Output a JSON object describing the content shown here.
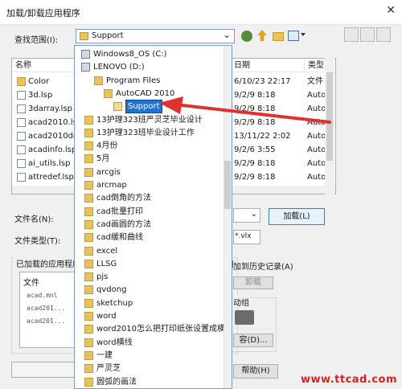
{
  "window": {
    "title": "加载/卸载应用程序",
    "close_glyph": "✕"
  },
  "search": {
    "label": "查找范围(I):",
    "current": "Support",
    "arrow": "⌄"
  },
  "columns": {
    "name": "名称",
    "date": "日期",
    "type": "类型"
  },
  "files": [
    {
      "name": "Color",
      "kind": "folder",
      "date": "6/10/23 22:17",
      "type": "文件"
    },
    {
      "name": "3d.lsp",
      "kind": "file",
      "date": "9/2/9 8:18",
      "type": "Autoc"
    },
    {
      "name": "3darray.lsp",
      "kind": "file",
      "date": "9/2/9 8:18",
      "type": "Autoc"
    },
    {
      "name": "acad2010.ls",
      "kind": "file",
      "date": "9/2/9 8:18",
      "type": "Autoc"
    },
    {
      "name": "acad2010do",
      "kind": "file",
      "date": "13/11/22 2:02",
      "type": "Autoc"
    },
    {
      "name": "acadinfo.lsp",
      "kind": "file",
      "date": "9/2/6 3:55",
      "type": "Autoc"
    },
    {
      "name": "ai_utils.lsp",
      "kind": "file",
      "date": "9/2/9 8:18",
      "type": "Autoc"
    },
    {
      "name": "attredef.lsp",
      "kind": "file",
      "date": "9/2/9 8:18",
      "type": "Autoc"
    }
  ],
  "dropdown": [
    {
      "text": "Windows8_OS (C:)",
      "kind": "drive",
      "indent": 0
    },
    {
      "text": "LENOVO (D:)",
      "kind": "drive",
      "indent": 0
    },
    {
      "text": "Program Files",
      "kind": "folder",
      "indent": 1
    },
    {
      "text": "AutoCAD 2010",
      "kind": "folder",
      "indent": 2
    },
    {
      "text": "Support",
      "kind": "folder-open",
      "indent": 3,
      "selected": true
    },
    {
      "text": "13护理323班严灵芝毕业设计",
      "kind": "folder",
      "indent": -1
    },
    {
      "text": "13护理323班毕业设计工作",
      "kind": "folder",
      "indent": -1
    },
    {
      "text": "4月份",
      "kind": "folder",
      "indent": -1
    },
    {
      "text": "5月",
      "kind": "folder",
      "indent": -1
    },
    {
      "text": "arcgis",
      "kind": "folder",
      "indent": -1
    },
    {
      "text": "arcmap",
      "kind": "folder",
      "indent": -1
    },
    {
      "text": "cad倒角的方法",
      "kind": "folder",
      "indent": -1
    },
    {
      "text": "cad批量打印",
      "kind": "folder",
      "indent": -1
    },
    {
      "text": "cad画圆的方法",
      "kind": "folder",
      "indent": -1
    },
    {
      "text": "cad缓和曲线",
      "kind": "folder",
      "indent": -1
    },
    {
      "text": "excel",
      "kind": "folder",
      "indent": -1
    },
    {
      "text": "LLSG",
      "kind": "folder",
      "indent": -1
    },
    {
      "text": "pjs",
      "kind": "folder",
      "indent": -1
    },
    {
      "text": "qvdong",
      "kind": "folder",
      "indent": -1
    },
    {
      "text": "sketchup",
      "kind": "folder",
      "indent": -1
    },
    {
      "text": "word",
      "kind": "folder",
      "indent": -1
    },
    {
      "text": "word2010怎么把打印纸张设置成横",
      "kind": "folder",
      "indent": -1
    },
    {
      "text": "word横线",
      "kind": "folder",
      "indent": -1
    },
    {
      "text": "一建",
      "kind": "folder",
      "indent": -1
    },
    {
      "text": "严灵芝",
      "kind": "folder",
      "indent": -1
    },
    {
      "text": "圆弧的画法",
      "kind": "folder",
      "indent": -1
    }
  ],
  "filename": {
    "label": "文件名(N):"
  },
  "filetype": {
    "label": "文件类型(T):",
    "value_tail": "*.vlx"
  },
  "buttons": {
    "load": "加载(L)",
    "unload_partial": "卸载",
    "add_partial": "容(D)...",
    "help_partial": "帮助(H)"
  },
  "history": {
    "label_partial": "加到历史记录(A)"
  },
  "startup": {
    "label_partial": "动组"
  },
  "loaded": {
    "label": "已加载的应用程序",
    "col": "文件",
    "items": [
      "acad.mnl",
      "acad201...",
      "acad201..."
    ]
  },
  "watermark": "www.ttcad.com",
  "colors": {
    "accent": "#1e73d6",
    "arrow": "#e03030"
  }
}
